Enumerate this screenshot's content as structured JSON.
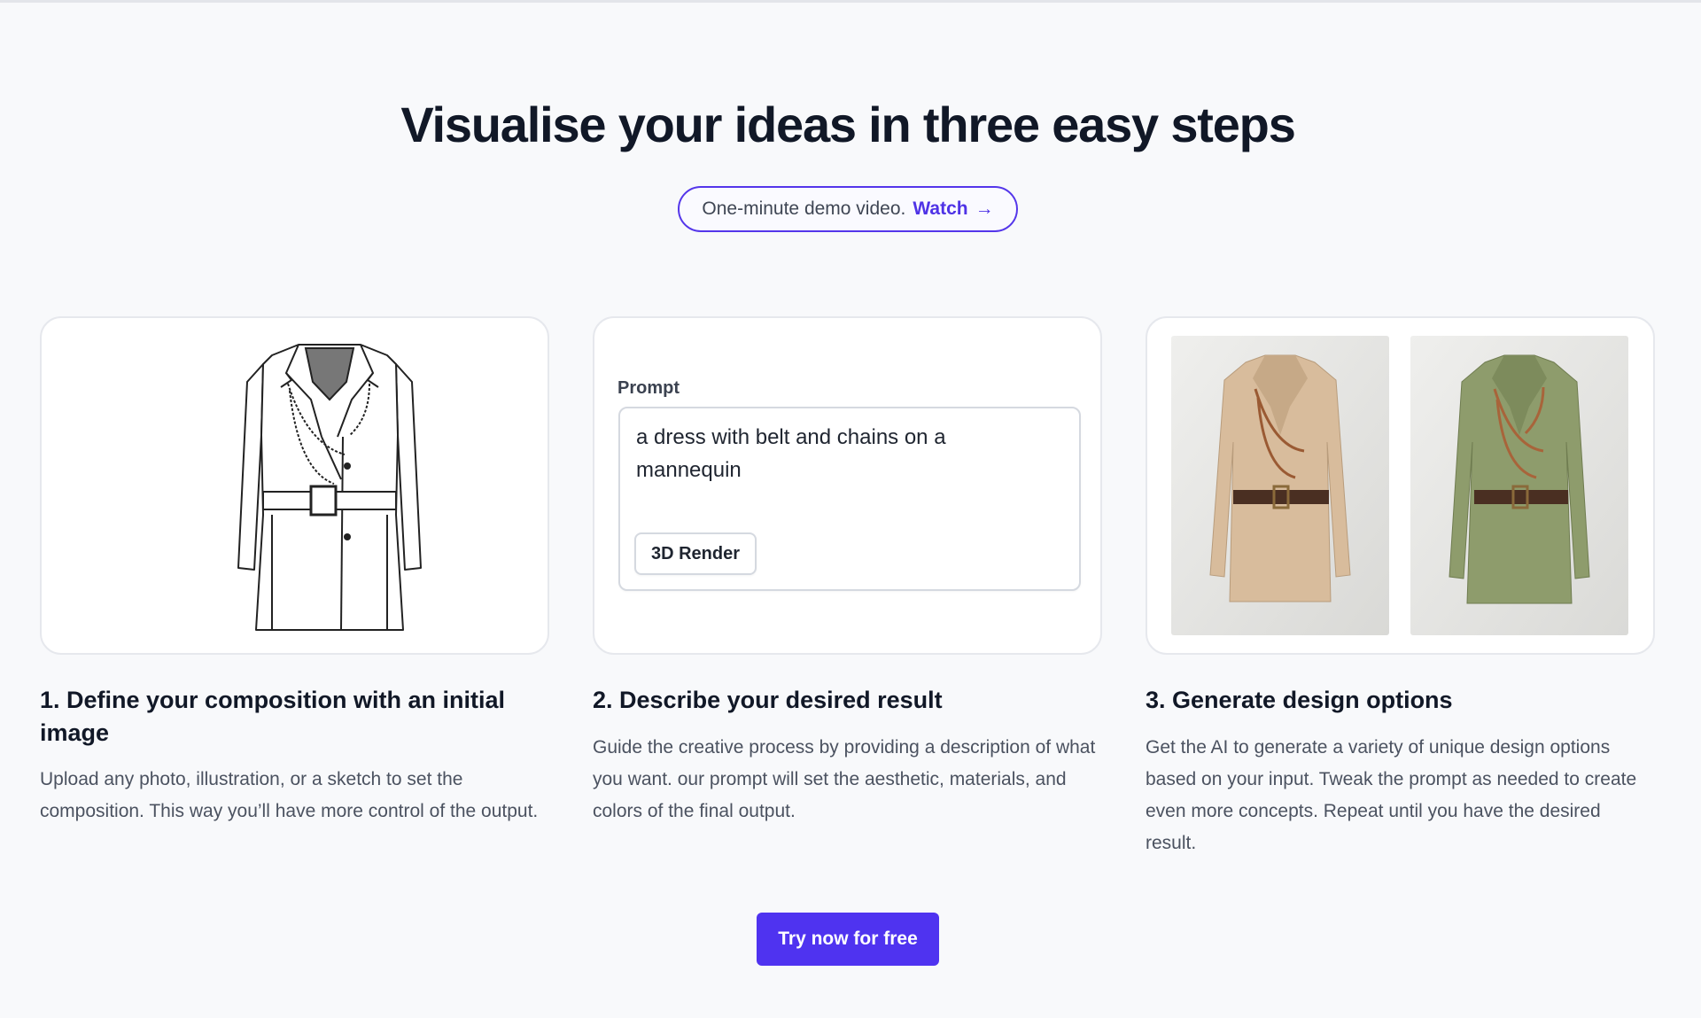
{
  "header": {
    "title": "Visualise your ideas in three easy steps",
    "demo_text": "One-minute demo video.",
    "demo_link": "Watch",
    "demo_arrow": "→"
  },
  "prompt_card": {
    "label": "Prompt",
    "value": "a dress with belt and chains on a mannequin",
    "style_button": "3D Render"
  },
  "steps": [
    {
      "title": "1. Define your composition with an initial image",
      "description": "Upload any photo, illustration, or a sketch to set the composition. This way you’ll have more control of the output."
    },
    {
      "title": "2. Describe your desired result",
      "description": "Guide the creative process by providing a description of what you want. our prompt will set the aesthetic, materials, and colors of the final output."
    },
    {
      "title": "3. Generate design options",
      "description": "Get the AI to generate a variety of unique design options based on your input. Tweak the prompt as needed to create even more concepts. Repeat until you have the desired result."
    }
  ],
  "cta": {
    "label": "Try now for free"
  },
  "colors": {
    "accent": "#4f33f0",
    "dress_beige": "#d9bfa2",
    "dress_green": "#8e9c6c",
    "belt": "#4a2f22",
    "chain": "#a8643a"
  },
  "icons": {
    "arrow": "arrow-right-icon"
  }
}
